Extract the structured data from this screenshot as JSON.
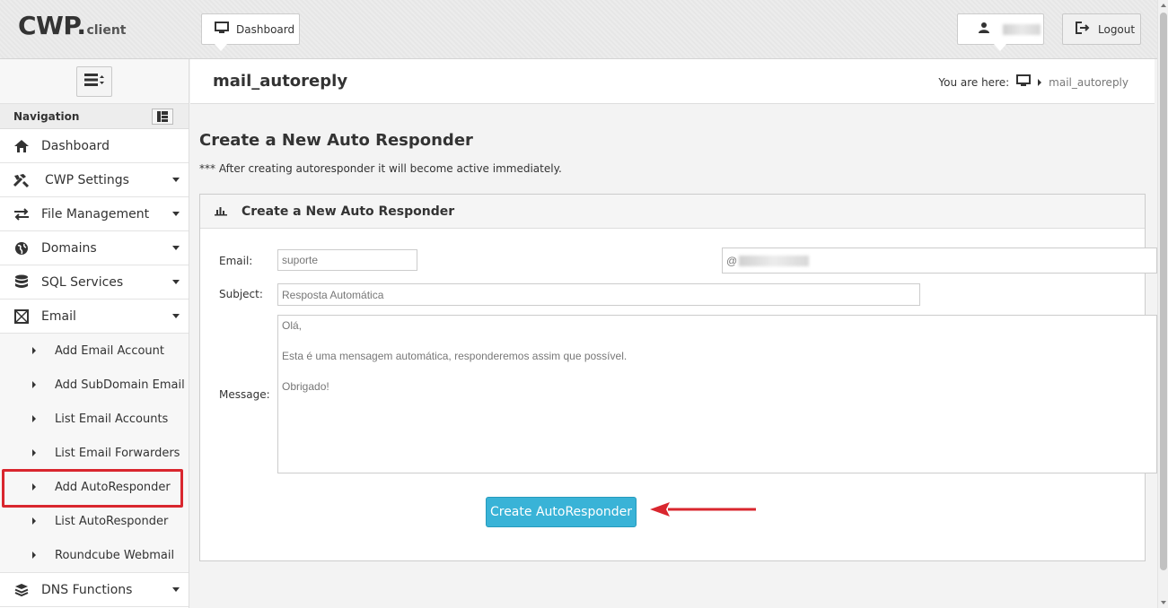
{
  "header": {
    "logo_main": "CWP.",
    "logo_sub": "client",
    "dashboard_button": "Dashboard",
    "logout_button": "Logout"
  },
  "sidebar": {
    "nav_title": "Navigation",
    "items": [
      {
        "label": "Dashboard",
        "icon": "home-icon"
      },
      {
        "label": "CWP Settings",
        "icon": "tools-icon"
      },
      {
        "label": "File Management",
        "icon": "transfer-arrows-icon"
      },
      {
        "label": "Domains",
        "icon": "globe-icon"
      },
      {
        "label": "SQL Services",
        "icon": "database-icon"
      },
      {
        "label": "Email",
        "icon": "envelope-icon"
      }
    ],
    "email_subitems": [
      "Add Email Account",
      "Add SubDomain Email",
      "List Email Accounts",
      "List Email Forwarders",
      "Add AutoResponder",
      "List AutoResponder",
      "Roundcube Webmail"
    ],
    "after_items": [
      {
        "label": "DNS Functions",
        "icon": "layers-icon"
      }
    ]
  },
  "page": {
    "title": "mail_autoreply",
    "breadcrumb_prefix": "You are here:",
    "breadcrumb_current": "mail_autoreply",
    "heading": "Create a New Auto Responder",
    "note": "*** After creating autoresponder it will become active immediately."
  },
  "form": {
    "panel_title": "Create a New Auto Responder",
    "email_label": "Email:",
    "email_value": "suporte",
    "domain_prefix": "@",
    "subject_label": "Subject:",
    "subject_value": "Resposta Automática",
    "message_label": "Message:",
    "message_lines": [
      "Olá,",
      "",
      "Esta é uma mensagem automática, responderemos assim que possível.",
      "",
      "Obrigado!"
    ],
    "submit_label": "Create AutoResponder"
  },
  "colors": {
    "accent_button": "#39b3d7",
    "highlight": "#d9262e"
  }
}
